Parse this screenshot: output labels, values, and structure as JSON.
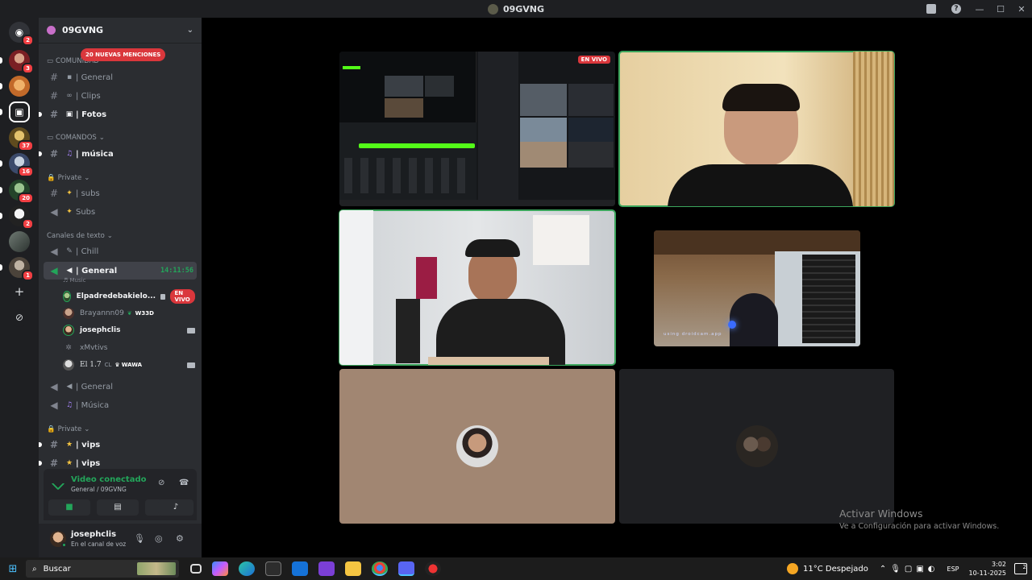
{
  "window": {
    "title": "09GVNG"
  },
  "rail": {
    "home_badge": "2",
    "badges": [
      "3",
      "37",
      "16",
      "20",
      "2",
      "1"
    ]
  },
  "server": {
    "name": "09GVNG",
    "mentions_pill": "20 NUEVAS MENCIONES"
  },
  "categories": {
    "comunidad": "COMUNIDAD",
    "comandos": "COMANDOS",
    "private1": "Private",
    "canales_texto": "Canales de texto",
    "private2": "Private"
  },
  "channels": {
    "general": "General",
    "clips": "Clips",
    "fotos": "Fotos",
    "musica": "música",
    "subs_text": "subs",
    "subs_voice": "Subs",
    "chill": "Chill",
    "general_voice": "General",
    "general_voice_time": "14:11:56",
    "general_voice_sub": "Music",
    "general1": "General",
    "musica_voice": "Música",
    "vips1": "vips",
    "vips2": "vips"
  },
  "voice_users": [
    {
      "name": "Elpadredebakielo...",
      "badge": "EN VIVO"
    },
    {
      "name": "Brayannn09",
      "tag": "W33D"
    },
    {
      "name": "josephclis"
    },
    {
      "name": "xMvtivs"
    },
    {
      "name": "El 1.7",
      "extra": "CL",
      "tag": "WAWA"
    }
  ],
  "voice_panel": {
    "status": "Video conectado",
    "where": "General / 09GVNG"
  },
  "user_panel": {
    "username": "josephclis",
    "status": "En el canal de voz"
  },
  "stage": {
    "live_badge": "EN VIVO",
    "cam_watermark": "using droidcam.app"
  },
  "activation": {
    "title": "Activar Windows",
    "subtitle": "Ve a Configuración para activar Windows."
  },
  "taskbar": {
    "search_placeholder": "Buscar",
    "weather": "11°C  Despejado",
    "lang": "ESP",
    "time": "3:02",
    "date": "10-11-2025",
    "notif_count": "2"
  },
  "colors": {
    "accent_green": "#23a55a",
    "mention_red": "#da373c",
    "sidebar_bg": "#2b2d31",
    "rail_bg": "#1e1f22"
  }
}
